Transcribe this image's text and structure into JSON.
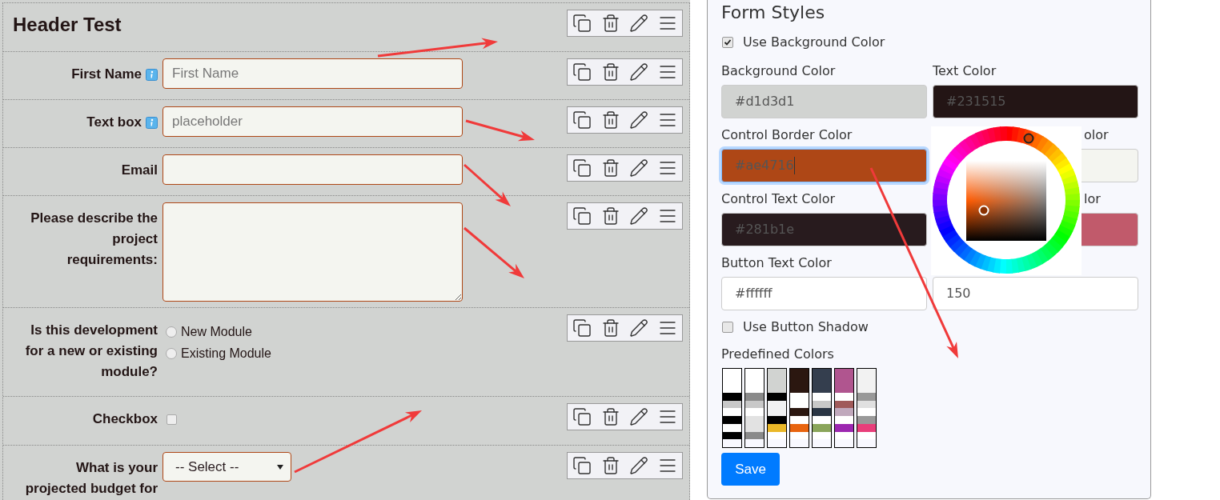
{
  "form_builder": {
    "fields": [
      {
        "kind": "header",
        "text": "Header Test"
      },
      {
        "kind": "text",
        "label": "First Name",
        "info": true,
        "placeholder": "First Name"
      },
      {
        "kind": "text",
        "label": "Text box",
        "info": true,
        "placeholder": "placeholder"
      },
      {
        "kind": "text",
        "label": "Email",
        "info": false
      },
      {
        "kind": "textarea",
        "label": "Please describe the project requirements:"
      },
      {
        "kind": "radio",
        "label": "Is this development for a new or existing module?",
        "options": [
          {
            "label": "New Module",
            "selected": false
          },
          {
            "label": "Existing Module",
            "selected": false
          }
        ]
      },
      {
        "kind": "checkbox",
        "label": "Checkbox",
        "checked": false
      },
      {
        "kind": "select",
        "label": "What is your projected budget for",
        "value": "-- Select --"
      }
    ]
  },
  "form_styles": {
    "title": "Form Styles",
    "use_background": {
      "label": "Use Background Color",
      "checked": true
    },
    "rows": [
      [
        {
          "label": "Background Color",
          "value": "#d1d3d1",
          "color": "#d1d3d1",
          "focused": false
        },
        {
          "label": "Text Color",
          "value": "#231515",
          "color": "#231515",
          "focused": false
        }
      ],
      [
        {
          "label": "Control Border Color",
          "value": "#ae4716",
          "color": "#ae4716",
          "focused": true
        },
        {
          "label": "olor",
          "color": "#f4f5f0",
          "focused": false
        }
      ],
      [
        {
          "label": "Control Text Color",
          "value": "#281b1e",
          "color": "#281b1e",
          "focused": false
        },
        {
          "label": "lor",
          "color": "#c15a6b",
          "focused": false
        }
      ],
      [
        {
          "label": "Button Text Color",
          "value": "#ffffff",
          "color": "#ffffff",
          "focused": false
        },
        {
          "value": "150",
          "focused": false
        }
      ]
    ],
    "use_shadow": {
      "label": "Use Button Shadow",
      "checked": false
    },
    "presets_label": "Predefined Colors",
    "presets": [
      {
        "bands": [
          {
            "color": "#ffffff"
          },
          {
            "color": "#000000"
          },
          {
            "color": "#c8c8c8"
          },
          {
            "color": "#ffffff"
          },
          {
            "color": "#000000"
          },
          {
            "color": "#ffffff"
          },
          {
            "color": "#000000"
          },
          {
            "color": "#f8f8ff"
          }
        ]
      },
      {
        "bands": [
          {
            "color": "#ffffff"
          },
          {
            "color": "#8a8a8a"
          },
          {
            "color": "#c8c8c8"
          },
          {
            "color": "#ffffff"
          },
          {
            "color": "#e2e2e2"
          },
          {
            "color": "#e2e2e2"
          },
          {
            "color": "#8a8a8a"
          },
          {
            "color": "#f8f8ff"
          }
        ]
      },
      {
        "bands": [
          {
            "color": "#d1d3d1"
          },
          {
            "color": "#000000"
          },
          {
            "color": "#f0f1f2"
          },
          {
            "color": "#f0f1f2"
          },
          {
            "color": "#000000"
          },
          {
            "color": "#eab828"
          },
          {
            "color": "#ffffff"
          },
          {
            "color": "#f8f8ff"
          }
        ]
      },
      {
        "bands": [
          {
            "color": "#2b1710"
          },
          {
            "color": "#ffffff"
          },
          {
            "color": "#ffffff"
          },
          {
            "color": "#2b1710"
          },
          {
            "color": "#ffffff"
          },
          {
            "color": "#e8640f"
          },
          {
            "color": "#ffffff"
          },
          {
            "color": "#f8f8ff"
          }
        ]
      },
      {
        "bands": [
          {
            "color": "#343e4e"
          },
          {
            "color": "#ffffff"
          },
          {
            "color": "#c8c8c8"
          },
          {
            "color": "#2a3544"
          },
          {
            "color": "#ffffff"
          },
          {
            "color": "#8aa55a"
          },
          {
            "color": "#ffffff"
          },
          {
            "color": "#f8f8ff"
          }
        ]
      },
      {
        "bands": [
          {
            "color": "#b0558f"
          },
          {
            "color": "#ffffff"
          },
          {
            "color": "#a05a5a"
          },
          {
            "color": "#c0a8bc"
          },
          {
            "color": "#ffffff"
          },
          {
            "color": "#9c27b0"
          },
          {
            "color": "#ffffff"
          },
          {
            "color": "#f8f8ff"
          }
        ]
      },
      {
        "bands": [
          {
            "color": "#f2f2f2"
          },
          {
            "color": "#999999"
          },
          {
            "color": "#e0e0e0"
          },
          {
            "color": "#ffffff"
          },
          {
            "color": "#999999"
          },
          {
            "color": "#e83e7a"
          },
          {
            "color": "#ffffff"
          },
          {
            "color": "#f8f8ff"
          }
        ]
      }
    ],
    "save": "Save"
  }
}
